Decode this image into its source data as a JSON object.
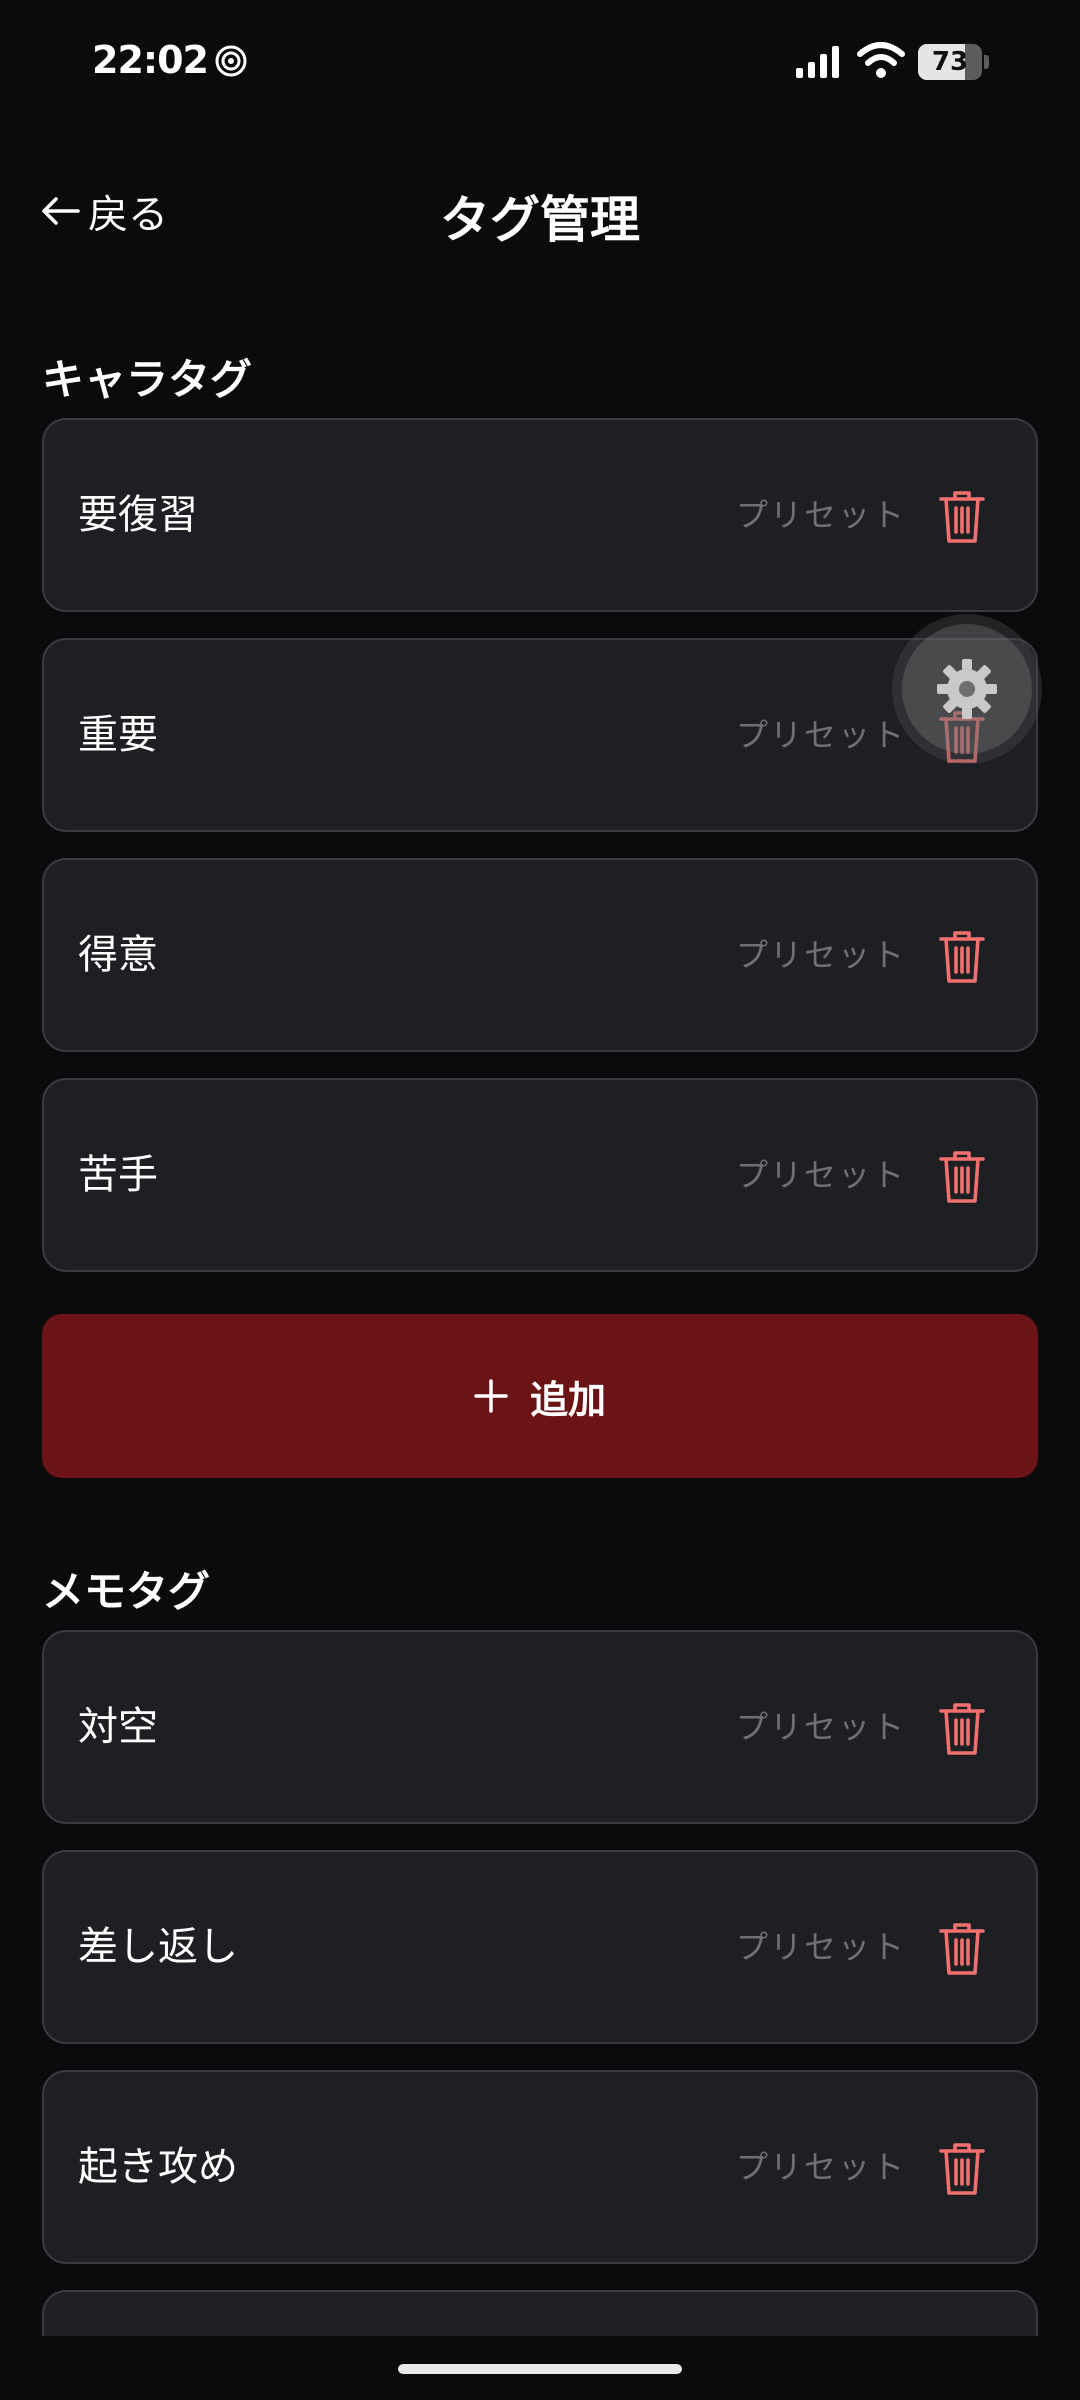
{
  "status_bar": {
    "time": "22:02",
    "battery_level": "73",
    "battery_fraction": 0.73,
    "icons": [
      "app-spiral-icon",
      "signal-icon",
      "wifi-icon",
      "battery-icon"
    ]
  },
  "header": {
    "back_label": "戻る",
    "title": "タグ管理"
  },
  "chara_section": {
    "title": "キャラタグ",
    "items": [
      {
        "label": "要復習",
        "meta": "プリセット"
      },
      {
        "label": "重要",
        "meta": "プリセット"
      },
      {
        "label": "得意",
        "meta": "プリセット"
      },
      {
        "label": "苦手",
        "meta": "プリセット"
      }
    ],
    "add_label": "追加"
  },
  "memo_section": {
    "title": "メモタグ",
    "items": [
      {
        "label": "対空",
        "meta": "プリセット"
      },
      {
        "label": "差し返し",
        "meta": "プリセット"
      },
      {
        "label": "起き攻め",
        "meta": "プリセット"
      }
    ]
  },
  "colors": {
    "background": "#0b0b0d",
    "card": "#1e1f23",
    "card_border": "#3a3b40",
    "accent": "#6b1416",
    "trash": "#f07070",
    "meta_text": "#6f7075"
  }
}
